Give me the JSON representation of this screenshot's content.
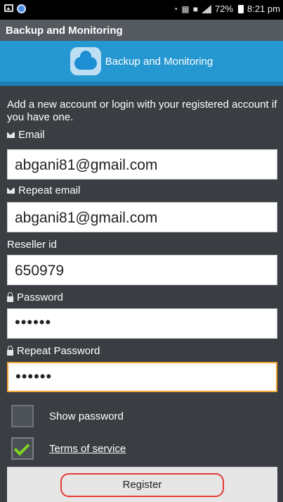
{
  "status_bar": {
    "battery": "72%",
    "time": "8:21 pm",
    "icons": [
      "image-icon",
      "app-dot-icon",
      "alarm-icon",
      "lte-icon",
      "cast-icon",
      "signal-icon",
      "battery-icon"
    ]
  },
  "app": {
    "title": "Backup and Monitoring"
  },
  "header": {
    "title": "Backup and Monitoring",
    "icon": "cloud-icon"
  },
  "form": {
    "intro": "Add a new account or login with your registered account if you have one.",
    "email_label": "Email",
    "email_value": "abgani81@gmail.com",
    "repeat_email_label": "Repeat email",
    "repeat_email_value": "abgani81@gmail.com",
    "reseller_label": "Reseller id",
    "reseller_value": "650979",
    "password_label": "Password",
    "password_value": "••••••",
    "repeat_password_label": "Repeat Password",
    "repeat_password_value": "••••••",
    "show_password_label": "Show password",
    "show_password_checked": false,
    "terms_label": "Terms of service",
    "terms_checked": true,
    "register_label": "Register"
  },
  "colors": {
    "header_blue": "#2597d1",
    "background": "#3a3e43",
    "active_border": "#f2a63a",
    "highlight_red": "#e53935",
    "check_green": "#7ed321"
  }
}
